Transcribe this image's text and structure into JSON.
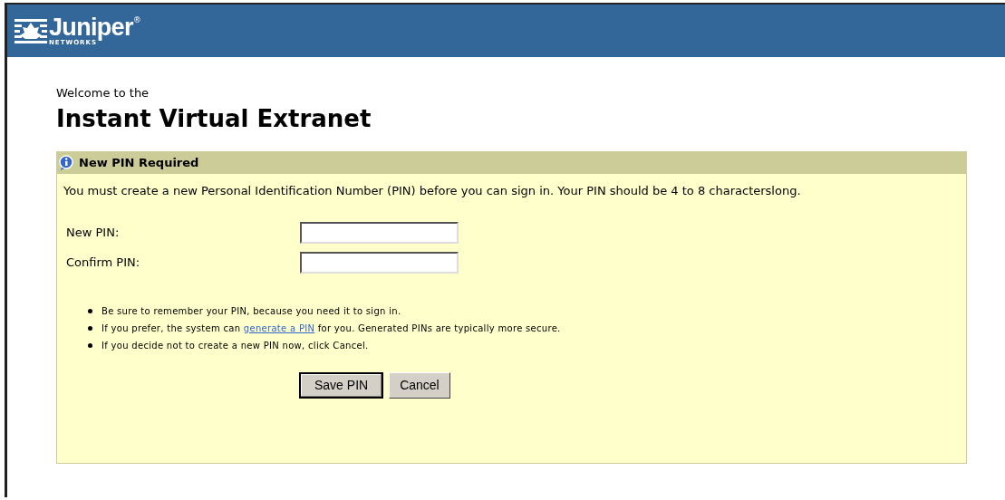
{
  "header": {
    "logo_text": "Juniper",
    "logo_subtext": "NETWORKS",
    "logo_mark": "®"
  },
  "welcome": "Welcome to the",
  "title": "Instant Virtual Extranet",
  "panel": {
    "title": "New PIN Required",
    "message": "You must create a new Personal Identification Number (PIN) before you can sign in. Your PIN should be 4 to 8 characterslong.",
    "fields": [
      {
        "label": "New PIN:"
      },
      {
        "label": "Confirm PIN:"
      }
    ],
    "notes": [
      {
        "text": "Be sure to remember your PIN, because you need it to sign in."
      },
      {
        "text": "If you prefer, the system can ",
        "link": "generate a PIN",
        "after": " for you. Generated PINs are typically more secure."
      },
      {
        "text": "If you decide not to create a new PIN now, click Cancel."
      }
    ],
    "buttons": [
      {
        "label": "Save PIN",
        "default": true
      },
      {
        "label": "Cancel",
        "default": false
      }
    ]
  }
}
